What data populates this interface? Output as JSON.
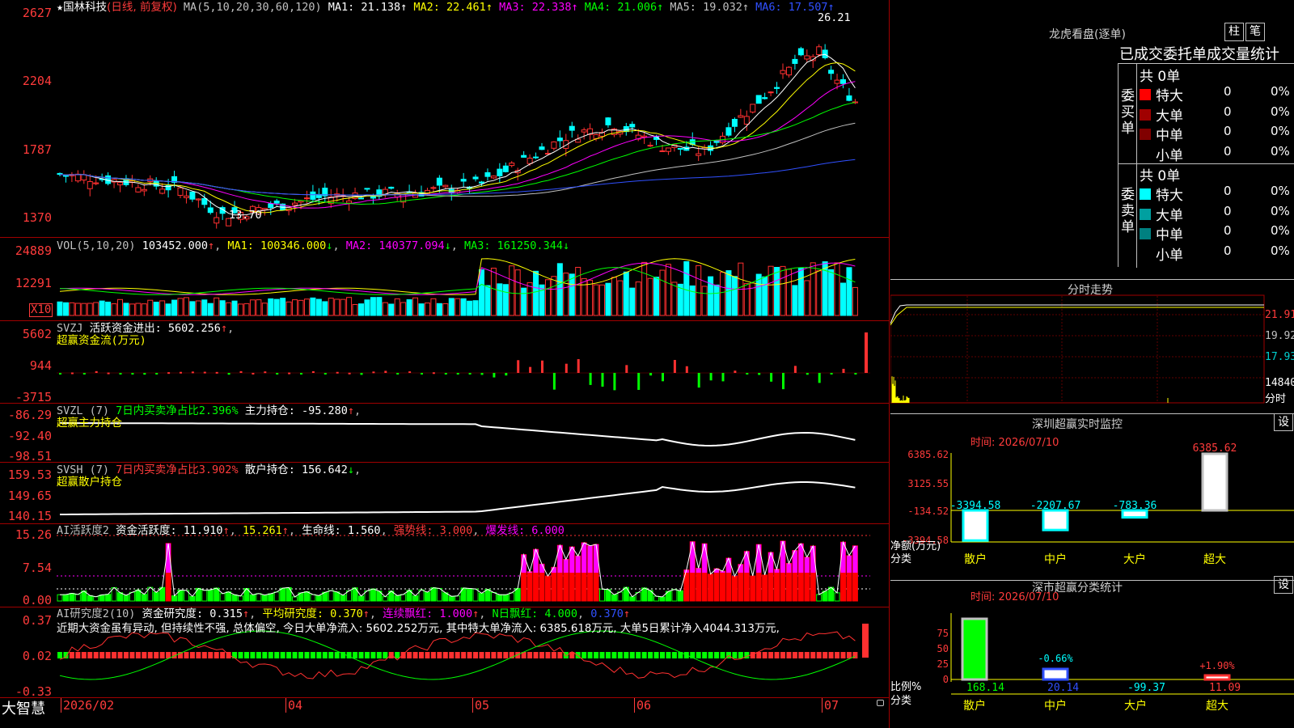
{
  "stock": {
    "star": "★",
    "name": "国林科技",
    "period": "(日线, 前复权)",
    "ma_params": "MA(5,10,20,30,60,120)",
    "ma_values": [
      {
        "label": "MA1: 21.138",
        "color": "#ffffff"
      },
      {
        "label": "MA2: 22.461",
        "color": "#ffff00"
      },
      {
        "label": "MA3: 22.338",
        "color": "#ff00ff"
      },
      {
        "label": "MA4: 21.006",
        "color": "#00ff00"
      },
      {
        "label": "MA5: 19.032",
        "color": "#c0c0c0"
      },
      {
        "label": "MA6: 17.507",
        "color": "#3050ff"
      }
    ],
    "arrow": "↑",
    "high_label": "26.21",
    "low_label": "13.70"
  },
  "price_axis": [
    "2627",
    "2204",
    "1787",
    "1370"
  ],
  "vol_pane": {
    "axis": [
      "24889",
      "12291"
    ],
    "unit": "X10",
    "header": "VOL(5,10,20)",
    "vol": "103452.000",
    "ma1": "MA1: 100346.000",
    "ma2": "MA2: 140377.094",
    "ma3": "MA3: 161250.344",
    "up": "↑",
    "down": "↓"
  },
  "svzj_pane": {
    "axis": [
      "5602",
      "944",
      "-3715"
    ],
    "name": "SVZJ",
    "text": "活跃资金进出: 5602.256",
    "sub": "超赢资金流(万元)"
  },
  "svzl_pane": {
    "axis": [
      "-86.29",
      "-92.40",
      "-98.51"
    ],
    "name": "SVZL (7)",
    "ratio": "7日内买卖净占比2.396%",
    "text": "主力持仓: -95.280",
    "sub": "超赢主力持仓"
  },
  "svsh_pane": {
    "axis": [
      "159.53",
      "149.65",
      "140.15"
    ],
    "name": "SVSH (7)",
    "ratio": "7日内买卖净占比3.902%",
    "text": "散户持仓: 156.642",
    "sub": "超赢散户持仓"
  },
  "ai_active_pane": {
    "axis": [
      "15.26",
      "7.54",
      "0.00"
    ],
    "name": "AI活跃度2",
    "t1": "资金活跃度: 11.910",
    "t2": "15.261",
    "t3": "生命线: 1.560",
    "t4": "强势线: 3.000",
    "t5": "爆发线: 6.000"
  },
  "ai_research_pane": {
    "axis": [
      "0.37",
      "0.02",
      "-0.33"
    ],
    "name": "AI研究度2(10)",
    "t1": "资金研究度: 0.315",
    "t2": "平均研究度: 0.370",
    "t3": "连续飘红: 1.000",
    "t4": "N日飘红: 4.000",
    "t5": "0.370",
    "comment": "近期大资金虽有异动, 但持续性不强, 总体偏空, 今日大单净流入: 5602.252万元, 其中特大单净流入: 6385.618万元, 大单5日累计净入4044.313万元,"
  },
  "bottom_axis": {
    "brand": "大智慧",
    "dates": [
      "2026/02",
      "04",
      "05",
      "06",
      "07"
    ]
  },
  "dragon_tiger": {
    "title": "龙虎看盘(逐单)",
    "btn1": "柱",
    "btn2": "笔",
    "header": "已成交委托单成交量统计",
    "buy_label": "委买单",
    "sell_label": "委卖单",
    "buy_total": "共 0单",
    "sell_total": "共 0单",
    "buy_rows": [
      {
        "name": "特大",
        "count": "0",
        "pct": "0%",
        "color": "#ff0000"
      },
      {
        "name": "大单",
        "count": "0",
        "pct": "0%",
        "color": "#a00000"
      },
      {
        "name": "中单",
        "count": "0",
        "pct": "0%",
        "color": "#800000"
      },
      {
        "name": "小单",
        "count": "0",
        "pct": "0%",
        "color": "#000000"
      }
    ],
    "sell_rows": [
      {
        "name": "特大",
        "count": "0",
        "pct": "0%",
        "color": "#00ffff"
      },
      {
        "name": "大单",
        "count": "0",
        "pct": "0%",
        "color": "#00a0a0"
      },
      {
        "name": "中单",
        "count": "0",
        "pct": "0%",
        "color": "#008080"
      },
      {
        "name": "小单",
        "count": "0",
        "pct": "0%",
        "color": "#000000"
      }
    ]
  },
  "intraday": {
    "title": "分时走势",
    "axis": [
      "21.91",
      "19.92",
      "17.93",
      "14840"
    ],
    "unit": "分时"
  },
  "sz_monitor": {
    "title": "深圳超赢实时监控",
    "btn": "设",
    "time": "时间: 2026/07/10",
    "axis": [
      "6385.62",
      "3125.55",
      "-134.52",
      "-3394.58"
    ],
    "ylabel": "净额(万元)",
    "xlabel": "分类",
    "values": [
      "-3394.58",
      "-2207.67",
      "-783.36",
      "6385.62"
    ],
    "cats": [
      "散户",
      "中户",
      "大户",
      "超大"
    ]
  },
  "sz_class": {
    "title": "深市超赢分类统计",
    "btn": "设",
    "time": "时间: 2026/07/10",
    "axis": [
      "75",
      "50",
      "25",
      "0"
    ],
    "ylabel": "比例%",
    "xlabel": "分类",
    "labels": [
      "-0.66%",
      "+1.90%"
    ],
    "values": [
      "168.14",
      "20.14",
      "-99.37",
      "11.09"
    ],
    "cats": [
      "散户",
      "中户",
      "大户",
      "超大"
    ]
  }
}
